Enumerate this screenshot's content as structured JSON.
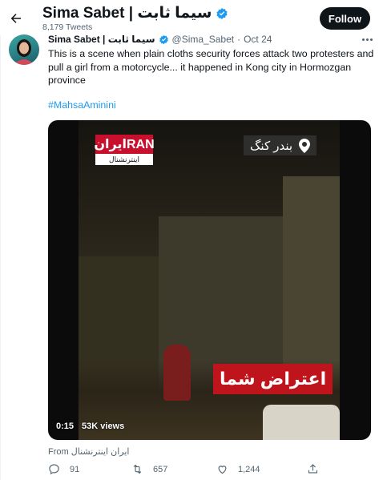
{
  "header": {
    "display_name": "Sima Sabet | سیما ثابت",
    "tweet_count": "8,179 Tweets",
    "follow_label": "Follow"
  },
  "tweet": {
    "author_name": "Sima Sabet | سیما ثابت",
    "handle": "@Sima_Sabet",
    "separator": "·",
    "date": "Oct 24",
    "text": "This is a scene when plain cloths security forces attack two protesters and pull a girl from a motorcycle... it happened in Kong city in Hormozgan province",
    "hashtag": "#MahsaAminini"
  },
  "video": {
    "logo_top": "ایرانRAN",
    "logo_sub": "اینترنشنال",
    "location_text": "بندر کنگ",
    "overlay_text": "اعتراض شما",
    "time": "0:15",
    "views": "53K views"
  },
  "source": {
    "label": "From",
    "name": "ایران اینترنشنال"
  },
  "actions": {
    "replies": "91",
    "retweets": "657",
    "likes": "1,244"
  },
  "colors": {
    "accent": "#1d9bf0",
    "follow_bg": "#0f1419",
    "muted": "#536471",
    "iran_red": "#c8102e",
    "overlay_red": "#c0141c"
  },
  "icons": [
    "back-arrow-icon",
    "verified-badge-icon",
    "more-icon",
    "location-pin-icon",
    "reply-icon",
    "retweet-icon",
    "like-icon",
    "share-icon"
  ]
}
